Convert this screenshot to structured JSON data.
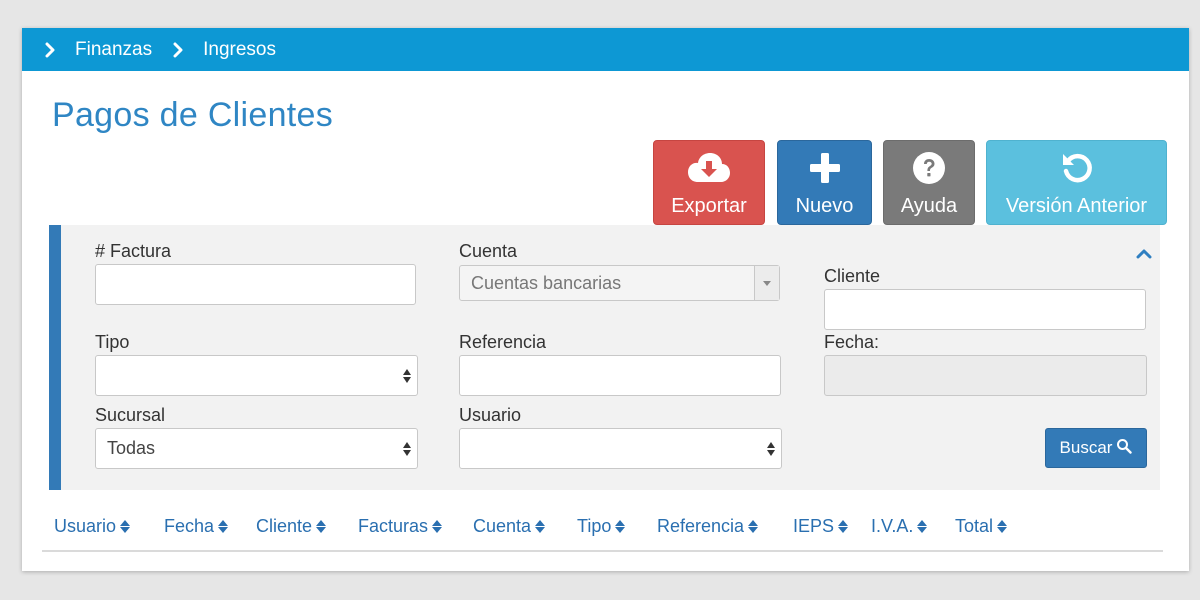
{
  "breadcrumb": {
    "items": [
      "Finanzas",
      "Ingresos"
    ]
  },
  "page": {
    "title": "Pagos de Clientes"
  },
  "toolbar": {
    "export_label": "Exportar",
    "new_label": "Nuevo",
    "help_label": "Ayuda",
    "previous_version_label": "Versión Anterior",
    "export_icon": "cloud-download-icon",
    "new_icon": "plus-icon",
    "help_icon": "question-circle-icon",
    "previous_version_icon": "undo-icon"
  },
  "filters": {
    "invoice": {
      "label": "# Factura",
      "value": ""
    },
    "account": {
      "label": "Cuenta",
      "value": "Cuentas bancarias"
    },
    "client": {
      "label": "Cliente",
      "value": ""
    },
    "type": {
      "label": "Tipo",
      "value": ""
    },
    "reference": {
      "label": "Referencia",
      "value": ""
    },
    "date": {
      "label": "Fecha:",
      "value": ""
    },
    "branch": {
      "label": "Sucursal",
      "value": "Todas"
    },
    "user": {
      "label": "Usuario",
      "value": ""
    },
    "search_label": "Buscar"
  },
  "table": {
    "columns": [
      "Usuario",
      "Fecha",
      "Cliente",
      "Facturas",
      "Cuenta",
      "Tipo",
      "Referencia",
      "IEPS",
      "I.V.A.",
      "Total"
    ]
  },
  "colors": {
    "breadcrumb_bar": "#0d98d4",
    "title": "#2f86c4",
    "export": "#d9534f",
    "new": "#337ab7",
    "help": "#7a7a7a",
    "previous_version": "#5bc0de",
    "column_header": "#2a6fb0"
  }
}
